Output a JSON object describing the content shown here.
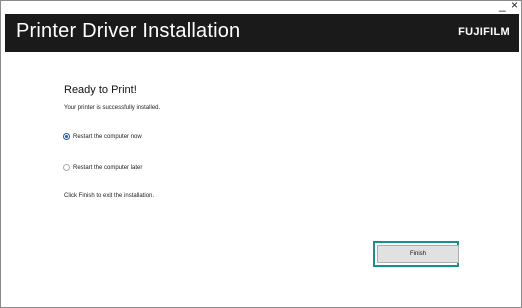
{
  "window": {
    "minimize_glyph": "_",
    "close_glyph": "×"
  },
  "header": {
    "title": "Printer Driver Installation",
    "brand": "FUJIFILM"
  },
  "content": {
    "heading": "Ready to Print!",
    "subtext": "Your printer is successfully installed.",
    "options": [
      {
        "label": "Restart the computer now",
        "selected": true
      },
      {
        "label": "Restart the computer later",
        "selected": false
      }
    ],
    "finish_note": "Click Finish to exit the installation."
  },
  "buttons": {
    "finish_label": "Finish"
  },
  "colors": {
    "header_bg": "#1a1a1a",
    "focus_ring": "#18908c",
    "radio_selected": "#1f5fae"
  }
}
